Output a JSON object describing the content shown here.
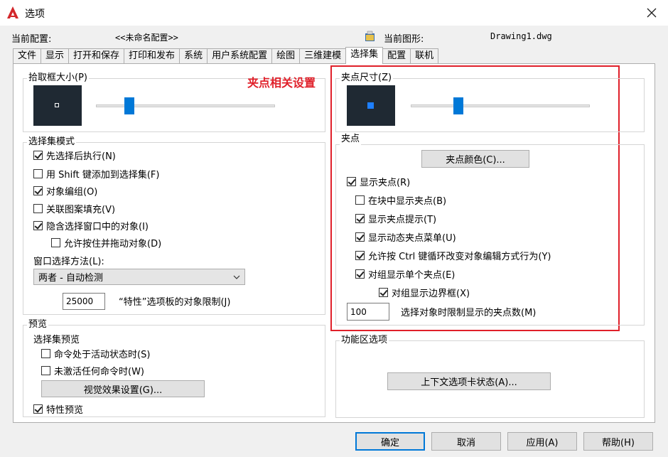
{
  "window": {
    "title": "选项"
  },
  "header": {
    "config_label": "当前配置:",
    "config_value": "<<未命名配置>>",
    "drawing_label": "当前图形:",
    "drawing_value": "Drawing1.dwg"
  },
  "tabs": [
    "文件",
    "显示",
    "打开和保存",
    "打印和发布",
    "系统",
    "用户系统配置",
    "绘图",
    "三维建模",
    "选择集",
    "配置",
    "联机"
  ],
  "active_tab": "选择集",
  "pickbox": {
    "label": "拾取框大小(P)",
    "slider_fraction": 0.17
  },
  "selection_modes": {
    "label": "选择集模式",
    "items": [
      {
        "label": "先选择后执行(N)",
        "checked": true
      },
      {
        "label": "用 Shift 键添加到选择集(F)",
        "checked": false
      },
      {
        "label": "对象编组(O)",
        "checked": true
      },
      {
        "label": "关联图案填充(V)",
        "checked": false
      },
      {
        "label": "隐含选择窗口中的对象(I)",
        "checked": true
      },
      {
        "label": "允许按住并拖动对象(D)",
        "checked": false
      }
    ],
    "window_method_label": "窗口选择方法(L):",
    "window_method_value": "两者 - 自动检测",
    "limit_value": "25000",
    "limit_label": "“特性”选项板的对象限制(J)"
  },
  "preview": {
    "label": "预览",
    "sub_label": "选择集预览",
    "items": [
      {
        "label": "命令处于活动状态时(S)",
        "checked": false
      },
      {
        "label": "未激活任何命令时(W)",
        "checked": false
      }
    ],
    "effects_button": "视觉效果设置(G)...",
    "property_preview": {
      "label": "特性预览",
      "checked": true
    }
  },
  "annotation": {
    "text": "夹点相关设置",
    "color": "#e0202a"
  },
  "grip_size": {
    "label": "夹点尺寸(Z)",
    "slider_fraction": 0.25
  },
  "grips": {
    "label": "夹点",
    "color_button": "夹点颜色(C)...",
    "items": [
      {
        "label": "显示夹点(R)",
        "checked": true
      },
      {
        "label": "在块中显示夹点(B)",
        "checked": false
      },
      {
        "label": "显示夹点提示(T)",
        "checked": true
      },
      {
        "label": "显示动态夹点菜单(U)",
        "checked": true
      },
      {
        "label": "允许按 Ctrl 键循环改变对象编辑方式行为(Y)",
        "checked": true
      },
      {
        "label": "对组显示单个夹点(E)",
        "checked": true
      },
      {
        "label": "对组显示边界框(X)",
        "checked": true
      }
    ],
    "limit_value": "100",
    "limit_label": "选择对象时限制显示的夹点数(M)"
  },
  "ribbon": {
    "label": "功能区选项",
    "context_button": "上下文选项卡状态(A)..."
  },
  "footer": {
    "ok": "确定",
    "cancel": "取消",
    "apply": "应用(A)",
    "help": "帮助(H)"
  },
  "colors": {
    "accent": "#0078d7",
    "preview_bg": "#1f2933",
    "highlight": "#e0202a"
  }
}
